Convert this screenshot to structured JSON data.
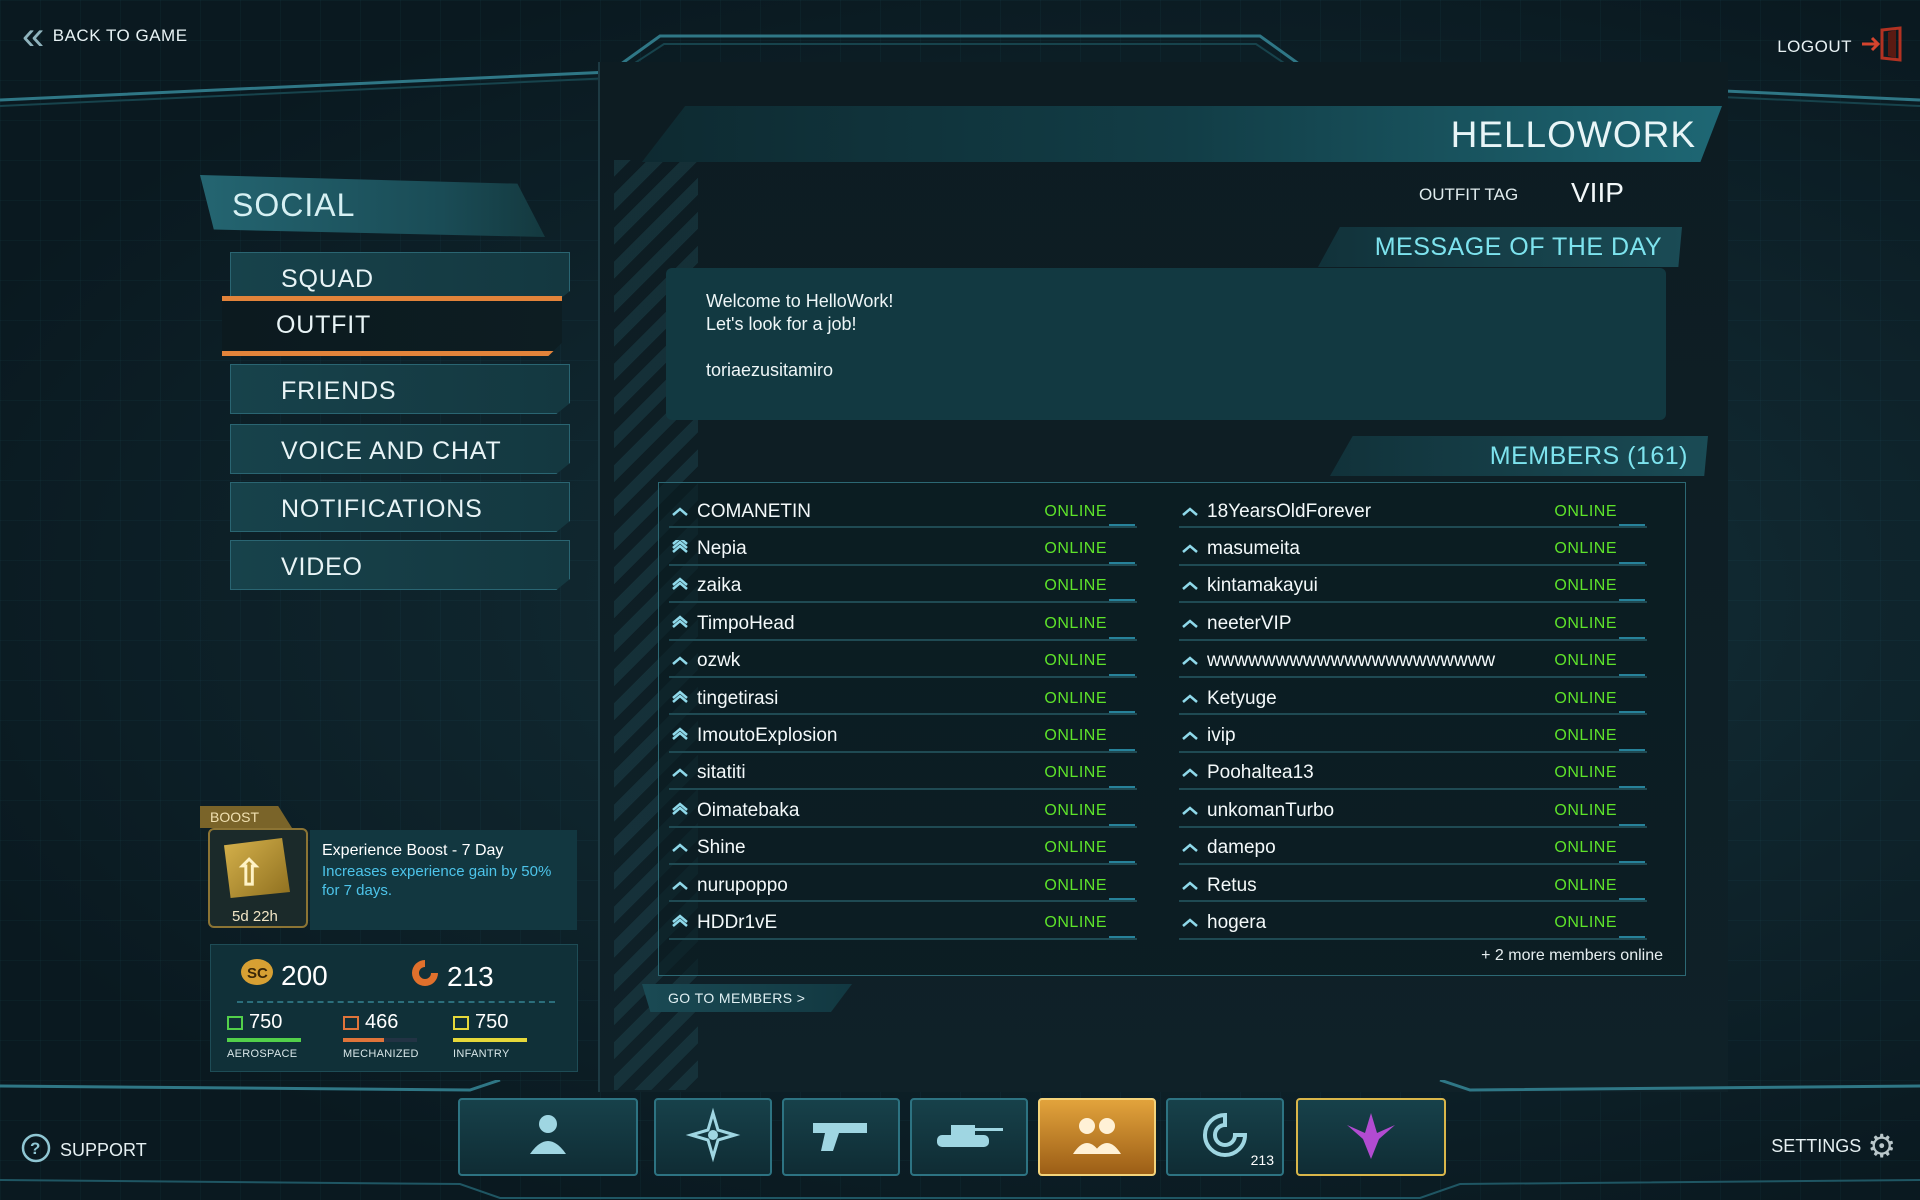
{
  "top": {
    "back_label": "BACK TO GAME",
    "logout_label": "LOGOUT"
  },
  "menu": {
    "header": "SOCIAL",
    "items": [
      {
        "label": "SQUAD",
        "active": false
      },
      {
        "label": "OUTFIT",
        "active": true
      },
      {
        "label": "FRIENDS",
        "active": false
      },
      {
        "label": "VOICE AND CHAT",
        "active": false
      },
      {
        "label": "NOTIFICATIONS",
        "active": false
      },
      {
        "label": "VIDEO",
        "active": false
      }
    ]
  },
  "boost": {
    "tab": "BOOST",
    "time_left": "5d 22h",
    "title": "Experience Boost - 7 Day",
    "description": "Increases experience gain by 50% for 7 days."
  },
  "currency": {
    "sc": "200",
    "certs": "213",
    "resources": [
      {
        "value": "750",
        "label": "AEROSPACE",
        "level": 1.0,
        "color": "#52d04a"
      },
      {
        "value": "466",
        "label": "MECHANIZED",
        "level": 0.55,
        "color": "#e0743a"
      },
      {
        "value": "750",
        "label": "INFANTRY",
        "level": 1.0,
        "color": "#e6d83a"
      }
    ]
  },
  "outfit": {
    "name": "HELLOWORK",
    "tag_label": "OUTFIT TAG",
    "tag_value": "VIIP",
    "motd_header": "MESSAGE OF THE DAY",
    "motd_lines": [
      "Welcome to HelloWork!",
      "Let's look for a job!",
      "",
      "toriaezusitamiro"
    ],
    "members_header": "MEMBERS (161)",
    "members_left": [
      {
        "name": "COMANETIN",
        "status": "ONLINE",
        "rank": "single"
      },
      {
        "name": "Nepia",
        "status": "ONLINE",
        "rank": "triple"
      },
      {
        "name": "zaika",
        "status": "ONLINE",
        "rank": "double"
      },
      {
        "name": "TimpoHead",
        "status": "ONLINE",
        "rank": "double"
      },
      {
        "name": "ozwk",
        "status": "ONLINE",
        "rank": "single"
      },
      {
        "name": "tingetirasi",
        "status": "ONLINE",
        "rank": "double"
      },
      {
        "name": "ImoutoExplosion",
        "status": "ONLINE",
        "rank": "double"
      },
      {
        "name": "sitatiti",
        "status": "ONLINE",
        "rank": "single"
      },
      {
        "name": "Oimatebaka",
        "status": "ONLINE",
        "rank": "double"
      },
      {
        "name": "Shine",
        "status": "ONLINE",
        "rank": "single"
      },
      {
        "name": "nurupoppo",
        "status": "ONLINE",
        "rank": "single"
      },
      {
        "name": "HDDr1vE",
        "status": "ONLINE",
        "rank": "double"
      }
    ],
    "members_right": [
      {
        "name": "18YearsOldForever",
        "status": "ONLINE",
        "rank": "single"
      },
      {
        "name": "masumeita",
        "status": "ONLINE",
        "rank": "single"
      },
      {
        "name": "kintamakayui",
        "status": "ONLINE",
        "rank": "single"
      },
      {
        "name": "neeterVIP",
        "status": "ONLINE",
        "rank": "single"
      },
      {
        "name": "wwwwwwwwwwwwwwwwwwwww",
        "status": "ONLINE",
        "rank": "single"
      },
      {
        "name": "Ketyuge",
        "status": "ONLINE",
        "rank": "single"
      },
      {
        "name": "ivip",
        "status": "ONLINE",
        "rank": "single"
      },
      {
        "name": "Poohaltea13",
        "status": "ONLINE",
        "rank": "single"
      },
      {
        "name": "unkomanTurbo",
        "status": "ONLINE",
        "rank": "single"
      },
      {
        "name": "damepo",
        "status": "ONLINE",
        "rank": "single"
      },
      {
        "name": "Retus",
        "status": "ONLINE",
        "rank": "single"
      },
      {
        "name": "hogera",
        "status": "ONLINE",
        "rank": "single"
      }
    ],
    "more_members": "+ 2 more members online",
    "goto_label": "GO TO MEMBERS >"
  },
  "bottom": {
    "support_label": "SUPPORT",
    "settings_label": "SETTINGS",
    "nav": [
      {
        "icon": "character-icon",
        "active": false
      },
      {
        "icon": "map-compass-icon",
        "active": false
      },
      {
        "icon": "weapon-pistol-icon",
        "active": false
      },
      {
        "icon": "vehicle-tank-icon",
        "active": false
      },
      {
        "icon": "social-group-icon",
        "active": true
      },
      {
        "icon": "certs-icon",
        "active": false,
        "badge": "213"
      },
      {
        "icon": "faction-emblem-icon",
        "active": false
      }
    ]
  }
}
